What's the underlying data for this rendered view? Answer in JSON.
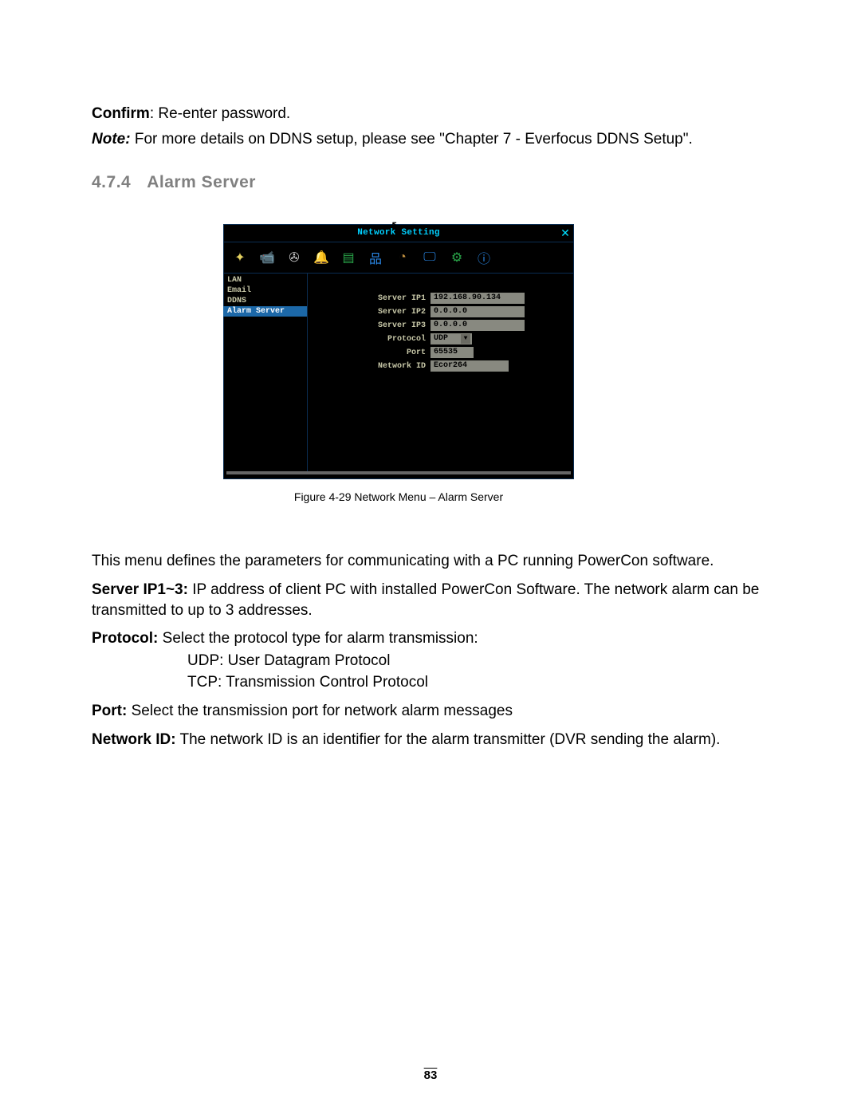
{
  "intro": {
    "confirm_label": "Confirm",
    "confirm_text": ": Re-enter password.",
    "note_label": "Note:",
    "note_text": " For more details on DDNS setup, please see \"Chapter 7 - Everfocus DDNS Setup\"."
  },
  "section": {
    "number": "4.7.4",
    "title": "Alarm Server"
  },
  "window": {
    "title": "Network Setting",
    "close": "✕",
    "sidebar": [
      {
        "label": "LAN",
        "active": false
      },
      {
        "label": "Email",
        "active": false
      },
      {
        "label": "DDNS",
        "active": false
      },
      {
        "label": "Alarm Server",
        "active": true
      }
    ],
    "fields": {
      "ip1_label": "Server IP1",
      "ip1_value": "192.168.90.134",
      "ip2_label": "Server IP2",
      "ip2_value": "0.0.0.0",
      "ip3_label": "Server IP3",
      "ip3_value": "0.0.0.0",
      "proto_label": "Protocol",
      "proto_value": "UDP",
      "port_label": "Port",
      "port_value": "65535",
      "netid_label": "Network ID",
      "netid_value": "Ecor264"
    }
  },
  "caption": "Figure 4-29  Network Menu – Alarm Server",
  "desc": {
    "p1": "This menu defines the parameters for communicating with a PC running PowerCon software.",
    "p2_b": "Server IP1~3:",
    "p2": " IP address of client PC with installed PowerCon Software. The network alarm can be transmitted to up to 3 addresses.",
    "p3_b": "Protocol:",
    "p3": " Select the protocol type for alarm transmission:",
    "p3a": "UDP: User Datagram Protocol",
    "p3b": "TCP: Transmission Control Protocol",
    "p4_b": "Port:",
    "p4": " Select the transmission port for network alarm messages",
    "p5_b": "Network ID:",
    "p5": " The network ID is an identifier for the alarm transmitter (DVR sending the alarm)."
  },
  "pagenum": "83"
}
